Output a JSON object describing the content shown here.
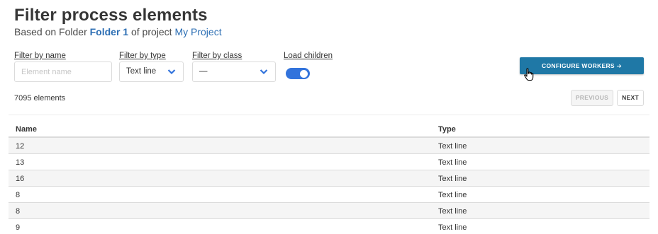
{
  "page": {
    "title": "Filter process elements",
    "subtitle_prefix": "Based on Folder ",
    "folder_name": "Folder 1",
    "subtitle_mid": " of project ",
    "project_name": "My Project"
  },
  "filters": {
    "name_label": "Filter by name",
    "name_placeholder": "Element name",
    "type_label": "Filter by type",
    "type_value": "Text line",
    "class_label": "Filter by class",
    "class_value": "—",
    "children_label": "Load children",
    "children_enabled": true
  },
  "actions": {
    "configure_label": "CONFIGURE WORKERS ➔"
  },
  "results": {
    "count_text": "7095 elements"
  },
  "pagination": {
    "previous_label": "PREVIOUS",
    "next_label": "NEXT"
  },
  "table": {
    "columns": [
      "Name",
      "Type"
    ],
    "rows": [
      {
        "name": "12",
        "type": "Text line"
      },
      {
        "name": "13",
        "type": "Text line"
      },
      {
        "name": "16",
        "type": "Text line"
      },
      {
        "name": "8",
        "type": "Text line"
      },
      {
        "name": "8",
        "type": "Text line"
      },
      {
        "name": "9",
        "type": "Text line"
      }
    ]
  },
  "colors": {
    "accent": "#2d6fb4",
    "configure_button": "#1f78a6",
    "toggle": "#3273dc"
  }
}
